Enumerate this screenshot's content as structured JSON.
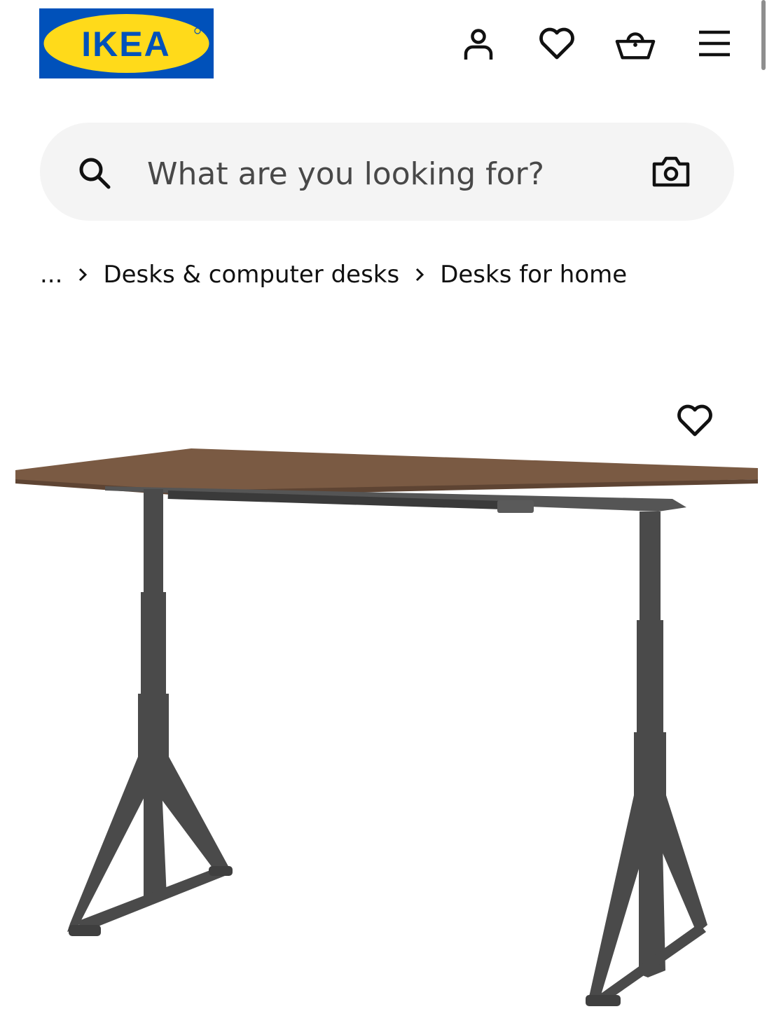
{
  "brand": {
    "logo_text": "IKEA"
  },
  "header": {
    "icons": [
      "person-icon",
      "heart-icon",
      "basket-icon",
      "hamburger-menu-icon"
    ]
  },
  "search": {
    "placeholder": "What are you looking for?"
  },
  "breadcrumb": {
    "ellipsis": "...",
    "items": [
      "Desks & computer desks",
      "Desks for home"
    ]
  },
  "product": {
    "image": "desk-with-brown-top-and-dark-grey-height-adjustable-legs",
    "colors": {
      "top": "#7a5a43",
      "legs": "#4a4a4a"
    }
  },
  "theme": {
    "ikea_blue": "#0051ba",
    "ikea_yellow": "#ffda1a",
    "search_bg": "#f4f4f4"
  }
}
